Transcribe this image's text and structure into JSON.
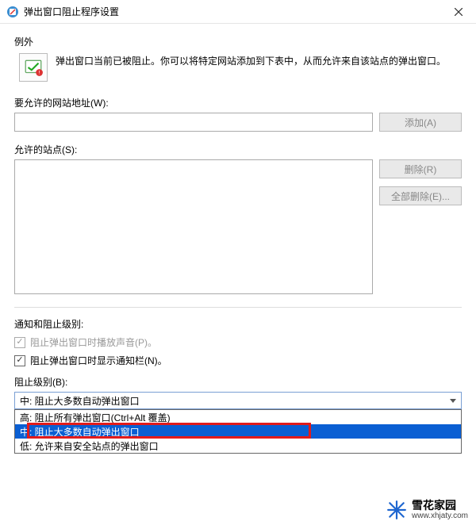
{
  "window": {
    "title": "弹出窗口阻止程序设置"
  },
  "exceptions": {
    "heading": "例外",
    "description": "弹出窗口当前已被阻止。你可以将特定网站添加到下表中，从而允许来自该站点的弹出窗口。",
    "address_label": "要允许的网站地址(W):",
    "address_value": "",
    "add_button": "添加(A)",
    "allowed_label": "允许的站点(S):",
    "remove_button": "删除(R)",
    "remove_all_button": "全部删除(E)..."
  },
  "notify": {
    "heading": "通知和阻止级别:",
    "play_sound_label": "阻止弹出窗口时播放声音(P)。",
    "show_bar_label": "阻止弹出窗口时显示通知栏(N)。",
    "level_label": "阻止级别(B):",
    "selected": "中: 阻止大多数自动弹出窗口",
    "options": [
      "高: 阻止所有弹出窗口(Ctrl+Alt 覆盖)",
      "中: 阻止大多数自动弹出窗口",
      "低: 允许来自安全站点的弹出窗口"
    ]
  },
  "watermark": {
    "brand": "雪花家园",
    "url": "www.xhjaty.com"
  }
}
